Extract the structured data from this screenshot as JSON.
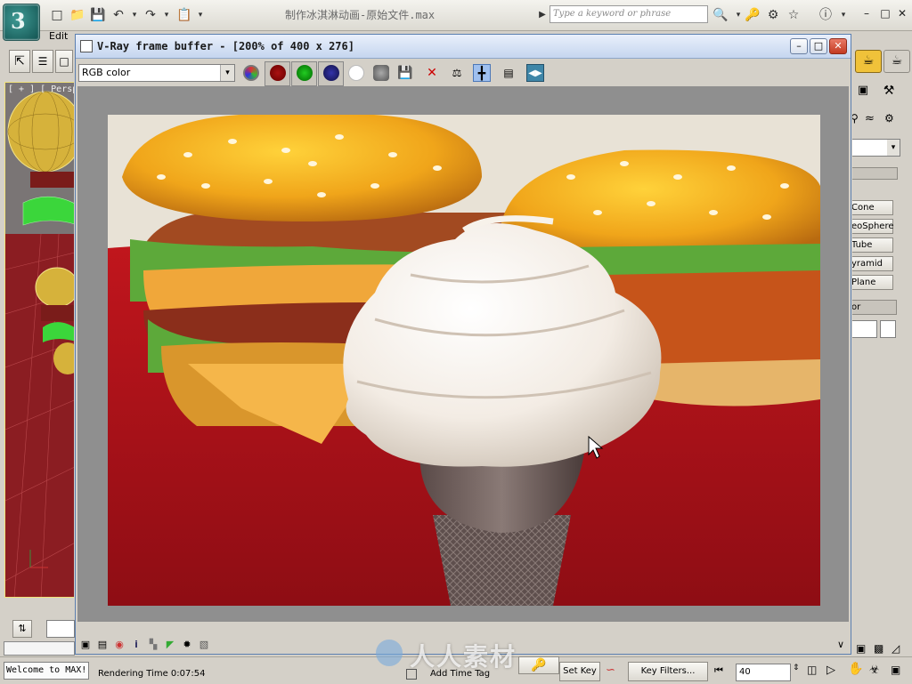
{
  "app": {
    "title": "制作冰淇淋动画-原始文件.max",
    "menu_edit": "Edit",
    "search_placeholder": "Type a keyword or phrase",
    "viewport_label": "[ + ] [ Perspe",
    "status_welcome": "Welcome to MAX!",
    "rendering_time": "Rendering Time  0:07:54",
    "add_time_tag": "Add Time Tag",
    "set_key": "Set Key",
    "key_filters": "Key Filters...",
    "frame_value": "40"
  },
  "command_panel": {
    "buttons": [
      "Cone",
      "eoSphere",
      "Tube",
      "yramid",
      "Plane",
      "or"
    ]
  },
  "frame_buffer": {
    "title": "V-Ray frame buffer - [200% of 400 x 276]",
    "channel": "RGB color",
    "tools": [
      "rgb-channels",
      "red-channel",
      "green-channel",
      "blue-channel",
      "alpha-channel",
      "monochrome",
      "save",
      "clear",
      "track-mouse",
      "region-render",
      "link-vfb",
      "compare"
    ],
    "status_icons": [
      "display-correction",
      "levels",
      "color-corrections",
      "info",
      "histogram",
      "lut",
      "icc",
      "color-clamp"
    ]
  },
  "watermark": "人人素材",
  "colors": {
    "frame_title_bg": "#c5d6ef",
    "close_red": "#c33a22",
    "render_bg": "#8f8f8f",
    "tablecloth": "#b3141c"
  }
}
